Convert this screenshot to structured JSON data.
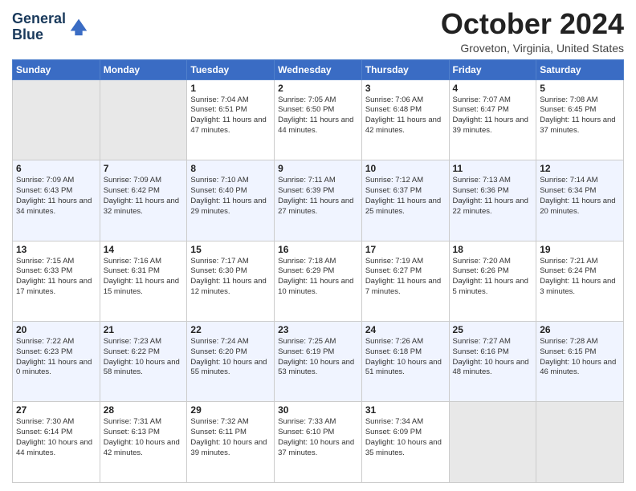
{
  "header": {
    "logo_line1": "General",
    "logo_line2": "Blue",
    "month": "October 2024",
    "location": "Groveton, Virginia, United States"
  },
  "weekdays": [
    "Sunday",
    "Monday",
    "Tuesday",
    "Wednesday",
    "Thursday",
    "Friday",
    "Saturday"
  ],
  "weeks": [
    [
      {
        "num": "",
        "info": ""
      },
      {
        "num": "",
        "info": ""
      },
      {
        "num": "1",
        "info": "Sunrise: 7:04 AM\nSunset: 6:51 PM\nDaylight: 11 hours and 47 minutes."
      },
      {
        "num": "2",
        "info": "Sunrise: 7:05 AM\nSunset: 6:50 PM\nDaylight: 11 hours and 44 minutes."
      },
      {
        "num": "3",
        "info": "Sunrise: 7:06 AM\nSunset: 6:48 PM\nDaylight: 11 hours and 42 minutes."
      },
      {
        "num": "4",
        "info": "Sunrise: 7:07 AM\nSunset: 6:47 PM\nDaylight: 11 hours and 39 minutes."
      },
      {
        "num": "5",
        "info": "Sunrise: 7:08 AM\nSunset: 6:45 PM\nDaylight: 11 hours and 37 minutes."
      }
    ],
    [
      {
        "num": "6",
        "info": "Sunrise: 7:09 AM\nSunset: 6:43 PM\nDaylight: 11 hours and 34 minutes."
      },
      {
        "num": "7",
        "info": "Sunrise: 7:09 AM\nSunset: 6:42 PM\nDaylight: 11 hours and 32 minutes."
      },
      {
        "num": "8",
        "info": "Sunrise: 7:10 AM\nSunset: 6:40 PM\nDaylight: 11 hours and 29 minutes."
      },
      {
        "num": "9",
        "info": "Sunrise: 7:11 AM\nSunset: 6:39 PM\nDaylight: 11 hours and 27 minutes."
      },
      {
        "num": "10",
        "info": "Sunrise: 7:12 AM\nSunset: 6:37 PM\nDaylight: 11 hours and 25 minutes."
      },
      {
        "num": "11",
        "info": "Sunrise: 7:13 AM\nSunset: 6:36 PM\nDaylight: 11 hours and 22 minutes."
      },
      {
        "num": "12",
        "info": "Sunrise: 7:14 AM\nSunset: 6:34 PM\nDaylight: 11 hours and 20 minutes."
      }
    ],
    [
      {
        "num": "13",
        "info": "Sunrise: 7:15 AM\nSunset: 6:33 PM\nDaylight: 11 hours and 17 minutes."
      },
      {
        "num": "14",
        "info": "Sunrise: 7:16 AM\nSunset: 6:31 PM\nDaylight: 11 hours and 15 minutes."
      },
      {
        "num": "15",
        "info": "Sunrise: 7:17 AM\nSunset: 6:30 PM\nDaylight: 11 hours and 12 minutes."
      },
      {
        "num": "16",
        "info": "Sunrise: 7:18 AM\nSunset: 6:29 PM\nDaylight: 11 hours and 10 minutes."
      },
      {
        "num": "17",
        "info": "Sunrise: 7:19 AM\nSunset: 6:27 PM\nDaylight: 11 hours and 7 minutes."
      },
      {
        "num": "18",
        "info": "Sunrise: 7:20 AM\nSunset: 6:26 PM\nDaylight: 11 hours and 5 minutes."
      },
      {
        "num": "19",
        "info": "Sunrise: 7:21 AM\nSunset: 6:24 PM\nDaylight: 11 hours and 3 minutes."
      }
    ],
    [
      {
        "num": "20",
        "info": "Sunrise: 7:22 AM\nSunset: 6:23 PM\nDaylight: 11 hours and 0 minutes."
      },
      {
        "num": "21",
        "info": "Sunrise: 7:23 AM\nSunset: 6:22 PM\nDaylight: 10 hours and 58 minutes."
      },
      {
        "num": "22",
        "info": "Sunrise: 7:24 AM\nSunset: 6:20 PM\nDaylight: 10 hours and 55 minutes."
      },
      {
        "num": "23",
        "info": "Sunrise: 7:25 AM\nSunset: 6:19 PM\nDaylight: 10 hours and 53 minutes."
      },
      {
        "num": "24",
        "info": "Sunrise: 7:26 AM\nSunset: 6:18 PM\nDaylight: 10 hours and 51 minutes."
      },
      {
        "num": "25",
        "info": "Sunrise: 7:27 AM\nSunset: 6:16 PM\nDaylight: 10 hours and 48 minutes."
      },
      {
        "num": "26",
        "info": "Sunrise: 7:28 AM\nSunset: 6:15 PM\nDaylight: 10 hours and 46 minutes."
      }
    ],
    [
      {
        "num": "27",
        "info": "Sunrise: 7:30 AM\nSunset: 6:14 PM\nDaylight: 10 hours and 44 minutes."
      },
      {
        "num": "28",
        "info": "Sunrise: 7:31 AM\nSunset: 6:13 PM\nDaylight: 10 hours and 42 minutes."
      },
      {
        "num": "29",
        "info": "Sunrise: 7:32 AM\nSunset: 6:11 PM\nDaylight: 10 hours and 39 minutes."
      },
      {
        "num": "30",
        "info": "Sunrise: 7:33 AM\nSunset: 6:10 PM\nDaylight: 10 hours and 37 minutes."
      },
      {
        "num": "31",
        "info": "Sunrise: 7:34 AM\nSunset: 6:09 PM\nDaylight: 10 hours and 35 minutes."
      },
      {
        "num": "",
        "info": ""
      },
      {
        "num": "",
        "info": ""
      }
    ]
  ]
}
